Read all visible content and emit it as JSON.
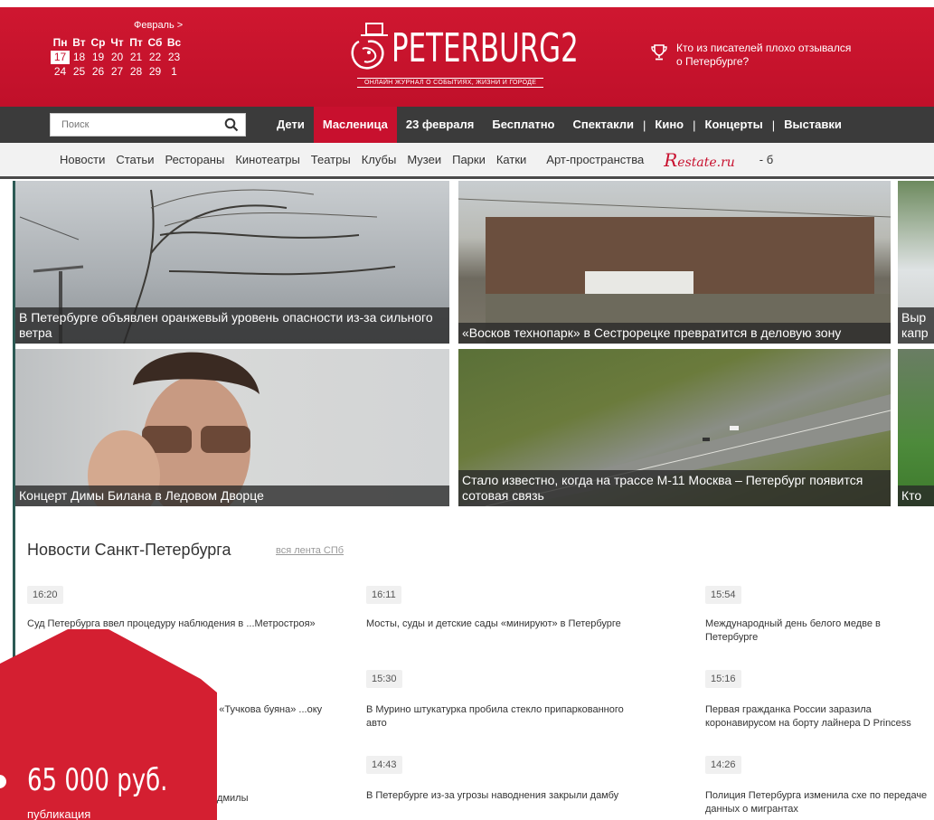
{
  "calendar": {
    "month": "Февраль >",
    "weekdays": [
      "Пн",
      "Вт",
      "Ср",
      "Чт",
      "Пт",
      "Сб",
      "Вс"
    ],
    "week1": [
      "17",
      "18",
      "19",
      "20",
      "21",
      "22",
      "23"
    ],
    "week2": [
      "24",
      "25",
      "26",
      "27",
      "28",
      "29",
      "1"
    ]
  },
  "logo": {
    "name": "PETERBURG2",
    "tagline": "ОНЛАЙН ЖУРНАЛ О СОБЫТИЯХ, ЖИЗНИ И ГОРОДЕ"
  },
  "promo": {
    "line1": "Кто из писателей плохо отзывался",
    "line2": "о Петербурге?"
  },
  "search": {
    "placeholder": "Поиск"
  },
  "nav": {
    "items": [
      "Дети",
      "Масленица",
      "23 февраля",
      "Бесплатно",
      "Спектакли",
      "Кино",
      "Концерты",
      "Выставки"
    ]
  },
  "subnav": {
    "items": [
      "Новости",
      "Статьи",
      "Рестораны",
      "Кинотеатры",
      "Театры",
      "Клубы",
      "Музеи",
      "Парки",
      "Катки",
      "Арт-пространства"
    ],
    "restate_r": "R",
    "restate_rest": "estate.ru",
    "restate_suffix": "- б"
  },
  "tiles": [
    {
      "caption": "В Петербурге объявлен оранжевый уровень опасности из-за сильного ветра"
    },
    {
      "caption": "«Восков технопарк» в Сестрорецке превратится в деловую зону"
    },
    {
      "caption": "Выр капр"
    },
    {
      "caption": "Концерт Димы Билана в Ледовом Дворце"
    },
    {
      "caption": "Стало известно, когда на трассе М-11 Москва – Петербург появится сотовая связь"
    },
    {
      "caption": "Кто"
    }
  ],
  "news": {
    "title": "Новости Санкт-Петербурга",
    "all_link": "вся лента СПб",
    "col1": [
      {
        "time": "16:20",
        "text": "Суд Петербурга ввел процедуру наблюдения в ...Метростроя»"
      },
      {
        "time": "",
        "text": "...т «Тучкова буяна» ...оку"
      },
      {
        "time": "",
        "text": "...одмилы"
      }
    ],
    "col2": [
      {
        "time": "16:11",
        "text": "Мосты, суды и детские сады «минируют» в Петербурге"
      },
      {
        "time": "15:30",
        "text": "В Мурино штукатурка пробила стекло припаркованного авто"
      },
      {
        "time": "14:43",
        "text": "В Петербурге из-за угрозы наводнения закрыли дамбу"
      }
    ],
    "col3": [
      {
        "time": "15:54",
        "text": "Международный день белого медве в Петербурге"
      },
      {
        "time": "15:16",
        "text": "Первая гражданка России заразила коронавирусом на борту лайнера D Princess"
      },
      {
        "time": "14:26",
        "text": "Полиция Петербурга изменила схе по передаче данных о мигрантах"
      }
    ]
  },
  "ad": {
    "price": "65 000 руб.",
    "sub": "публикация"
  },
  "colors": {
    "brand_red": "#c8102e",
    "nav_dark": "#3b3b3b",
    "accent_green": "#2c5a54"
  }
}
